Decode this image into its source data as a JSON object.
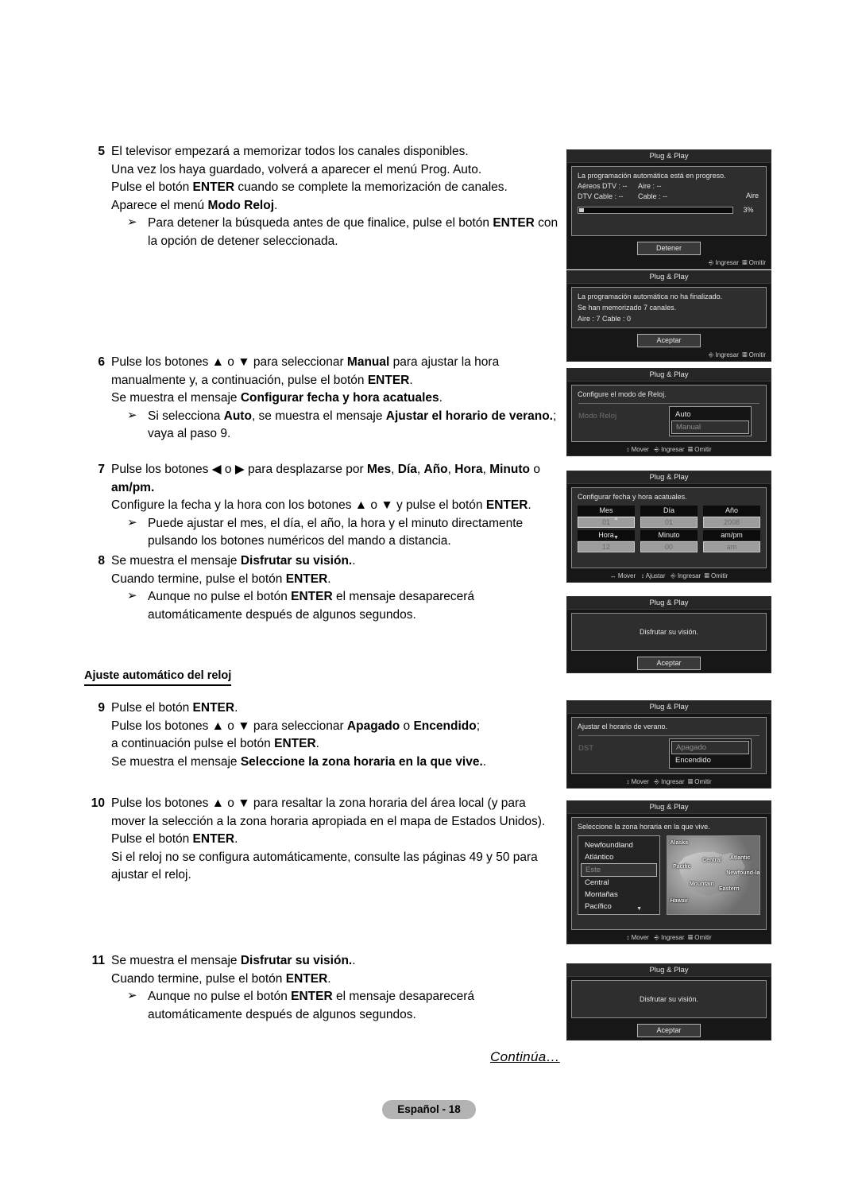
{
  "document": {
    "continued_label": "Continúa…",
    "page_badge": "Español - 18",
    "section_heading": "Ajuste automático del reloj"
  },
  "steps": [
    {
      "num": "5",
      "lines": [
        [
          {
            "t": "El televisor empezará a memorizar todos los canales disponibles.",
            "b": false
          }
        ],
        [
          {
            "t": "Una vez los haya guardado, volverá a aparecer el menú Prog. Auto.",
            "b": false
          }
        ],
        [
          {
            "t": "Pulse el botón ",
            "b": false
          },
          {
            "t": "ENTER",
            "b": true
          },
          {
            "t": " cuando se complete la memorización de canales.",
            "b": false
          }
        ],
        [
          {
            "t": "Aparece el menú ",
            "b": false
          },
          {
            "t": "Modo Reloj",
            "b": true
          },
          {
            "t": ".",
            "b": false
          }
        ]
      ],
      "bullets": [
        [
          {
            "t": "Para detener la búsqueda antes de que finalice, pulse el botón ",
            "b": false
          },
          {
            "t": "ENTER",
            "b": true
          },
          {
            "t": " con la opción de detener seleccionada.",
            "b": false
          }
        ]
      ]
    },
    {
      "num": "6",
      "lines": [
        [
          {
            "t": "Pulse los botones ▲ o ▼ para seleccionar ",
            "b": false
          },
          {
            "t": "Manual",
            "b": true
          },
          {
            "t": " para ajustar la hora",
            "b": false
          }
        ],
        [
          {
            "t": "manualmente y, a continuación, pulse el botón ",
            "b": false
          },
          {
            "t": "ENTER",
            "b": true
          },
          {
            "t": ".",
            "b": false
          }
        ],
        [
          {
            "t": "Se muestra el mensaje ",
            "b": false
          },
          {
            "t": "Configurar fecha y hora acatuales",
            "b": true
          },
          {
            "t": ".",
            "b": false
          }
        ]
      ],
      "bullets": [
        [
          {
            "t": "Si selecciona ",
            "b": false
          },
          {
            "t": "Auto",
            "b": true
          },
          {
            "t": ", se muestra el mensaje ",
            "b": false
          },
          {
            "t": "Ajustar el horario de verano.",
            "b": true
          },
          {
            "t": "; vaya al paso 9.",
            "b": false
          }
        ]
      ]
    },
    {
      "num": "7",
      "lines": [
        [
          {
            "t": "Pulse los botones ◀ o ▶ para desplazarse por ",
            "b": false
          },
          {
            "t": "Mes",
            "b": true
          },
          {
            "t": ", ",
            "b": false
          },
          {
            "t": "Día",
            "b": true
          },
          {
            "t": ", ",
            "b": false
          },
          {
            "t": "Año",
            "b": true
          },
          {
            "t": ", ",
            "b": false
          },
          {
            "t": "Hora",
            "b": true
          },
          {
            "t": ", ",
            "b": false
          },
          {
            "t": "Minuto",
            "b": true
          },
          {
            "t": " o",
            "b": false
          }
        ],
        [
          {
            "t": "am/pm.",
            "b": true
          }
        ],
        [
          {
            "t": "Configure la fecha y la hora con los botones ▲ o ▼ y pulse el botón ",
            "b": false
          },
          {
            "t": "ENTER",
            "b": true
          },
          {
            "t": ".",
            "b": false
          }
        ]
      ],
      "bullets": [
        [
          {
            "t": "Puede ajustar el mes, el día, el año, la hora y el minuto directamente pulsando los botones numéricos del mando a distancia.",
            "b": false
          }
        ]
      ]
    },
    {
      "num": "8",
      "lines": [
        [
          {
            "t": "Se muestra el mensaje ",
            "b": false
          },
          {
            "t": "Disfrutar su visión.",
            "b": true
          },
          {
            "t": ".",
            "b": false
          }
        ],
        [
          {
            "t": "Cuando termine, pulse el botón ",
            "b": false
          },
          {
            "t": "ENTER",
            "b": true
          },
          {
            "t": ".",
            "b": false
          }
        ]
      ],
      "bullets": [
        [
          {
            "t": "Aunque no pulse el botón ",
            "b": false
          },
          {
            "t": "ENTER",
            "b": true
          },
          {
            "t": " el mensaje desaparecerá automáticamente después de algunos segundos.",
            "b": false
          }
        ]
      ]
    },
    {
      "num": "9",
      "lines": [
        [
          {
            "t": "Pulse el botón ",
            "b": false
          },
          {
            "t": "ENTER",
            "b": true
          },
          {
            "t": ".",
            "b": false
          }
        ],
        [
          {
            "t": "Pulse los botones ▲ o ▼ para seleccionar ",
            "b": false
          },
          {
            "t": "Apagado",
            "b": true
          },
          {
            "t": " o ",
            "b": false
          },
          {
            "t": "Encendido",
            "b": true
          },
          {
            "t": ";",
            "b": false
          }
        ],
        [
          {
            "t": "a continuación pulse el botón ",
            "b": false
          },
          {
            "t": "ENTER",
            "b": true
          },
          {
            "t": ".",
            "b": false
          }
        ],
        [
          {
            "t": "Se muestra el mensaje ",
            "b": false
          },
          {
            "t": "Seleccione la zona horaria en la que vive.",
            "b": true
          },
          {
            "t": ".",
            "b": false
          }
        ]
      ],
      "bullets": []
    },
    {
      "num": "10",
      "lines": [
        [
          {
            "t": "Pulse los botones ▲ o ▼ para resaltar la zona horaria del área local (y para",
            "b": false
          }
        ],
        [
          {
            "t": "mover la selección a la zona horaria apropiada en el mapa de Estados Unidos).",
            "b": false
          }
        ],
        [
          {
            "t": "Pulse el botón ",
            "b": false
          },
          {
            "t": "ENTER",
            "b": true
          },
          {
            "t": ".",
            "b": false
          }
        ],
        [
          {
            "t": "Si el reloj no se configura automáticamente, consulte las páginas 49 y 50 para",
            "b": false
          }
        ],
        [
          {
            "t": "ajustar el reloj.",
            "b": false
          }
        ]
      ],
      "bullets": []
    },
    {
      "num": "11",
      "lines": [
        [
          {
            "t": "Se muestra el mensaje ",
            "b": false
          },
          {
            "t": "Disfrutar su visión.",
            "b": true
          },
          {
            "t": ".",
            "b": false
          }
        ],
        [
          {
            "t": "Cuando termine, pulse el botón ",
            "b": false
          },
          {
            "t": "ENTER",
            "b": true
          },
          {
            "t": ".",
            "b": false
          }
        ]
      ],
      "bullets": [
        [
          {
            "t": "Aunque no pulse el botón ",
            "b": false
          },
          {
            "t": "ENTER",
            "b": true
          },
          {
            "t": " el mensaje desaparecerá automáticamente después de algunos segundos.",
            "b": false
          }
        ]
      ]
    }
  ],
  "osd": {
    "title": "Plug & Play",
    "foot_enter": "Ingresar",
    "foot_skip": "Omitir",
    "foot_move": "Mover",
    "foot_adjust": "Ajustar",
    "scan": {
      "message": "La programación automática está en progreso.",
      "rows": [
        {
          "k": "Aéreos DTV : --",
          "v": "Aire : --"
        },
        {
          "k": "DTV Cable : --",
          "v": "Cable : --"
        }
      ],
      "source_label": "Aire",
      "percent": "3%",
      "progress_value": 3,
      "button": "Detener"
    },
    "incomplete": {
      "line1": "La programación automática no ha finalizado.",
      "line2": "Se han memorizado 7 canales.",
      "line3": "Aire : 7     Cable : 0",
      "button": "Aceptar"
    },
    "clockmode": {
      "message": "Configure el modo de Reloj.",
      "label": "Modo Reloj",
      "options": [
        "Auto",
        "Manual"
      ],
      "selected": "Manual"
    },
    "datetime": {
      "message": "Configurar fecha y hora acatuales.",
      "fields": [
        {
          "label": "Mes",
          "value": "01",
          "active": true
        },
        {
          "label": "Día",
          "value": "01",
          "active": false
        },
        {
          "label": "Año",
          "value": "2008",
          "active": false
        },
        {
          "label": "Hora",
          "value": "12",
          "active": false
        },
        {
          "label": "Minuto",
          "value": "00",
          "active": false
        },
        {
          "label": "am/pm",
          "value": "am",
          "active": false
        }
      ]
    },
    "enjoy": {
      "message": "Disfrutar su visión.",
      "button": "Aceptar"
    },
    "dst": {
      "message": "Ajustar el horario de verano.",
      "label": "DST",
      "options": [
        "Apagado",
        "Encendido"
      ],
      "selected": "Apagado"
    },
    "timezone": {
      "message": "Seleccione la zona horaria en la que vive.",
      "items": [
        "Newfoundland",
        "Atlántico",
        "Este",
        "Central",
        "Montañas",
        "Pacífico"
      ],
      "selected": "Este",
      "map_labels": [
        "Alaska",
        "Pacific",
        "Central",
        "Atlantic",
        "Newfound-land",
        "Mountain",
        "Eastern",
        "Hawaii"
      ]
    }
  }
}
